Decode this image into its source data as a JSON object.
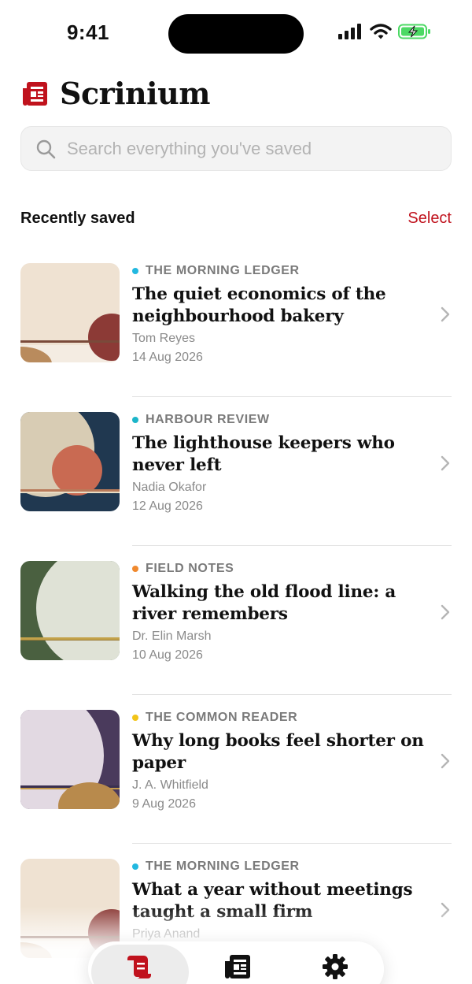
{
  "status_bar": {
    "time": "9:41"
  },
  "app": {
    "title": "Scrinium",
    "accent": "#c0121d"
  },
  "search": {
    "placeholder": "Search everything you've saved"
  },
  "section": {
    "title": "Recently saved",
    "action": "Select"
  },
  "articles": [
    {
      "source": "THE MORNING LEDGER",
      "source_color": "#22b8e0",
      "title": "The quiet economics of the neighbourhood bakery",
      "author": "Tom Reyes",
      "date": "14 Aug 2026"
    },
    {
      "source": "HARBOUR REVIEW",
      "source_color": "#1cb5c9",
      "title": "The lighthouse keepers who never left",
      "author": "Nadia Okafor",
      "date": "12 Aug 2026"
    },
    {
      "source": "FIELD NOTES",
      "source_color": "#f0892e",
      "title": "Walking the old flood line: a river remembers",
      "author": "Dr. Elin Marsh",
      "date": "10 Aug 2026"
    },
    {
      "source": "THE COMMON READER",
      "source_color": "#f2c418",
      "title": "Why long books feel shorter on paper",
      "author": "J. A. Whitfield",
      "date": "9 Aug 2026"
    },
    {
      "source": "THE MORNING LEDGER",
      "source_color": "#22b8e0",
      "title": "What a year without meetings taught a small firm",
      "author": "Priya Anand",
      "date": ""
    }
  ],
  "tab_bar": {
    "items": [
      "saved-icon",
      "news-icon",
      "settings-icon"
    ],
    "active": "saved-icon"
  }
}
